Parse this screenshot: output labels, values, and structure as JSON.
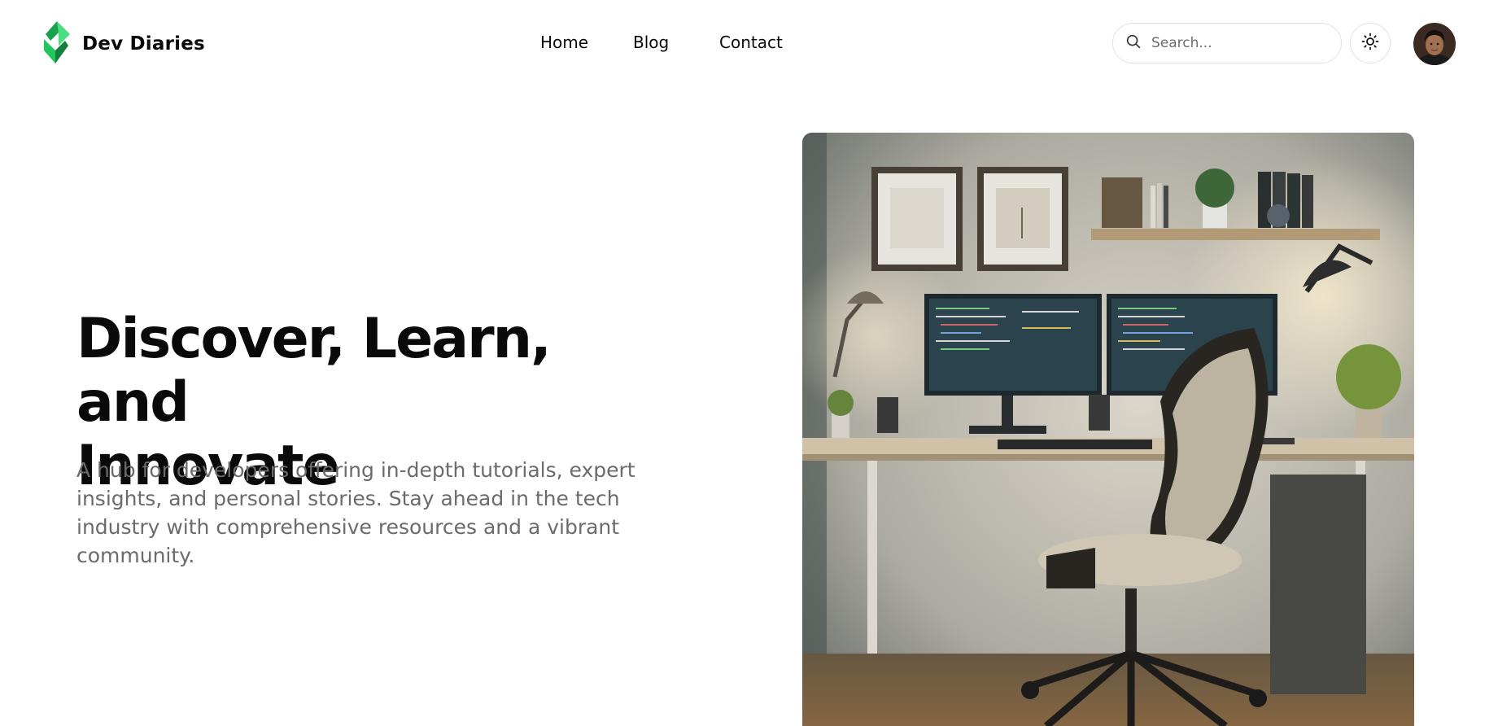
{
  "brand": {
    "name": "Dev Diaries",
    "logo_icon": "diamond-logo-icon",
    "accent": "#22c55e"
  },
  "nav": {
    "items": [
      {
        "label": "Home"
      },
      {
        "label": "Blog"
      },
      {
        "label": "Contact"
      }
    ]
  },
  "search": {
    "placeholder": "Search...",
    "value": "",
    "icon": "search-icon"
  },
  "theme_toggle": {
    "icon": "sun-icon"
  },
  "avatar": {
    "alt": "User avatar"
  },
  "hero": {
    "title_line1": "Discover, Learn, and",
    "title_line2": "Innovate",
    "description": "A hub for developers offering in-depth tutorials, expert insights, and personal stories. Stay ahead in the tech industry with comprehensive resources and a vibrant community."
  },
  "colors": {
    "text": "#0a0a0a",
    "muted": "#6b6b6b",
    "border": "#e2e2e2",
    "background": "#ffffff"
  }
}
